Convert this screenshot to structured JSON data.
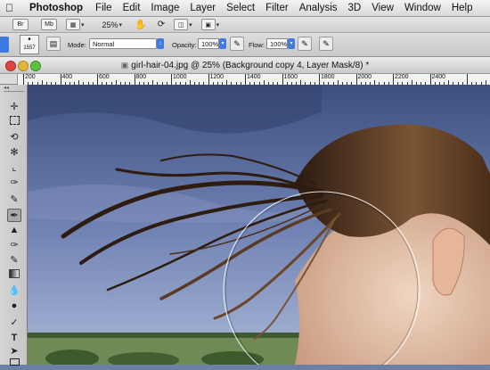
{
  "menubar": {
    "app_name": "Photoshop",
    "items": [
      "File",
      "Edit",
      "Image",
      "Layer",
      "Select",
      "Filter",
      "Analysis",
      "3D",
      "View",
      "Window",
      "Help"
    ]
  },
  "appbar": {
    "bridge_label": "Br",
    "minibridge_label": "Mb",
    "zoom_value": "25%"
  },
  "options": {
    "brush_size": "1557",
    "mode_label": "Mode:",
    "mode_value": "Normal",
    "opacity_label": "Opacity:",
    "opacity_value": "100%",
    "flow_label": "Flow:",
    "flow_value": "100%"
  },
  "document": {
    "title": "girl-hair-04.jpg @ 25% (Background copy 4, Layer Mask/8) *"
  },
  "ruler": {
    "labels": [
      "200",
      "400",
      "600",
      "800",
      "1000",
      "1200",
      "1400",
      "1600",
      "1800",
      "2000",
      "2200",
      "2400"
    ]
  },
  "tools": {
    "icons": [
      "move-icon",
      "marquee-icon",
      "lasso-icon",
      "quick-selection-icon",
      "crop-icon",
      "eyedropper-icon",
      "spot-healing-icon",
      "brush-icon",
      "clone-stamp-icon",
      "history-brush-icon",
      "eraser-icon",
      "gradient-icon",
      "blur-icon",
      "dodge-icon",
      "pen-icon",
      "type-icon",
      "path-selection-icon",
      "rectangle-icon"
    ],
    "active": "brush-icon"
  },
  "colors": {
    "sky_top": "#3d4f7e",
    "sky_bottom": "#a9b8d8",
    "hair": "#3a2415",
    "skin": "#e3c2aa",
    "field": "#6f8a55",
    "toolbar_accent": "#3d7be0"
  }
}
